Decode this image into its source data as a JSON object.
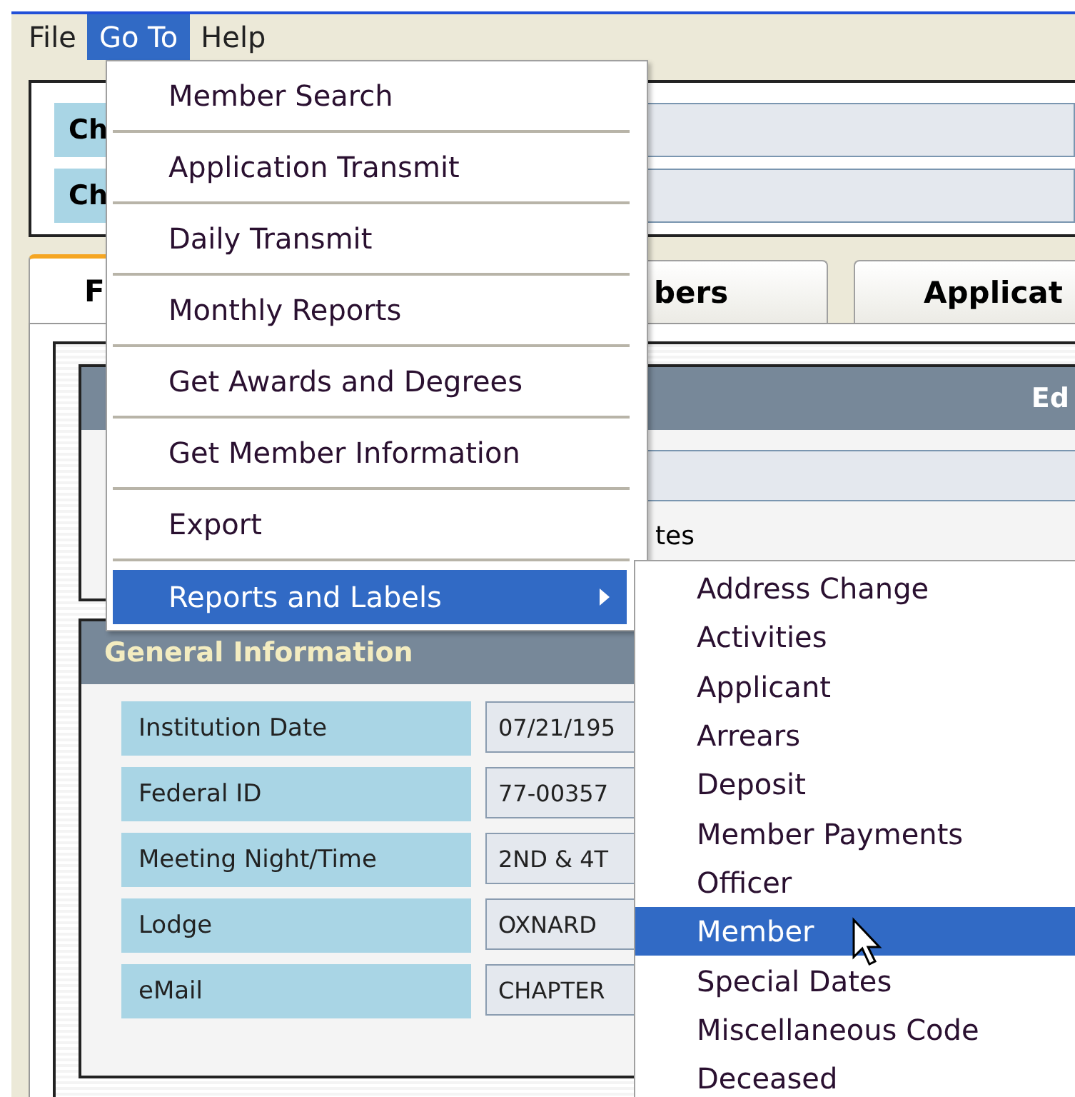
{
  "menubar": [
    {
      "label": "File",
      "selected": false
    },
    {
      "label": "Go To",
      "selected": true
    },
    {
      "label": "Help",
      "selected": false
    }
  ],
  "header_fields": [
    {
      "label": "Ch"
    },
    {
      "label": "Ch"
    }
  ],
  "tabs": [
    {
      "label": "F",
      "selected": true
    },
    {
      "label": "bers",
      "selected": false
    },
    {
      "label": "Applicat",
      "selected": false
    }
  ],
  "top_section": {
    "header": "Ed",
    "row_text": "tes"
  },
  "general_information": {
    "title": "General Information",
    "fields": [
      {
        "label": "Institution Date",
        "value": "07/21/195"
      },
      {
        "label": "Federal ID",
        "value": "77-00357"
      },
      {
        "label": "Meeting Night/Time",
        "value": "2ND & 4T"
      },
      {
        "label": "Lodge",
        "value": "OXNARD"
      },
      {
        "label": "eMail",
        "value": "CHAPTER"
      }
    ]
  },
  "goto_menu": [
    {
      "label": "Member Search",
      "selected": false,
      "submenu": false
    },
    {
      "label": "Application Transmit",
      "selected": false,
      "submenu": false
    },
    {
      "label": "Daily Transmit",
      "selected": false,
      "submenu": false
    },
    {
      "label": "Monthly Reports",
      "selected": false,
      "submenu": false
    },
    {
      "label": "Get Awards and Degrees",
      "selected": false,
      "submenu": false
    },
    {
      "label": "Get Member Information",
      "selected": false,
      "submenu": false
    },
    {
      "label": "Export",
      "selected": false,
      "submenu": false
    },
    {
      "label": "Reports and Labels",
      "selected": true,
      "submenu": true
    }
  ],
  "reports_submenu": [
    {
      "label": "Address Change",
      "selected": false
    },
    {
      "label": "Activities",
      "selected": false
    },
    {
      "label": "Applicant",
      "selected": false
    },
    {
      "label": "Arrears",
      "selected": false
    },
    {
      "label": "Deposit",
      "selected": false
    },
    {
      "label": "Member Payments",
      "selected": false
    },
    {
      "label": "Officer",
      "selected": false
    },
    {
      "label": "Member",
      "selected": true
    },
    {
      "label": "Special Dates",
      "selected": false
    },
    {
      "label": "Miscellaneous Code",
      "selected": false
    },
    {
      "label": "Deceased",
      "selected": false
    }
  ]
}
